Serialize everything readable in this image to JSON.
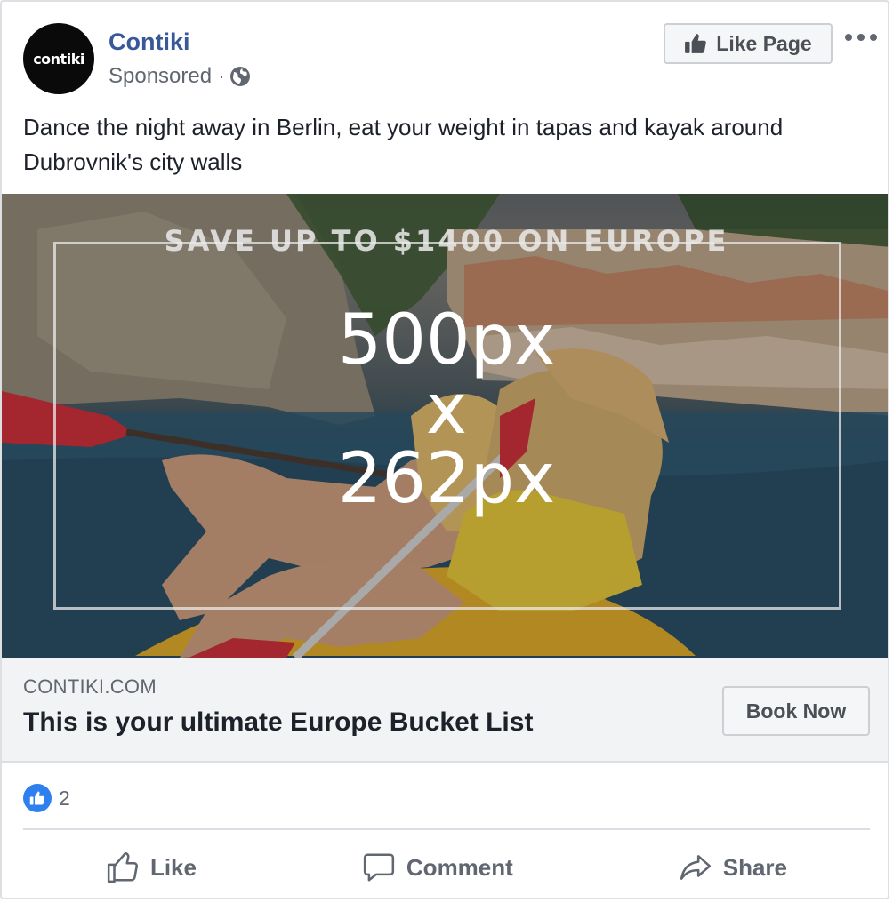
{
  "post": {
    "page_name": "Contiki",
    "avatar_text": "contiki",
    "sponsored_label": "Sponsored",
    "separator": "·",
    "privacy_icon": "globe-icon",
    "like_page_label": "Like Page",
    "more_icon": "ellipsis-icon",
    "body_text": "Dance the night away in Berlin, eat your weight in tapas and kayak around Dubrovnik's city walls"
  },
  "image": {
    "promo_text": "SAVE UP TO $1400 ON EUROPE",
    "dimension_line_1": "500px",
    "dimension_line_2": "x",
    "dimension_line_3": "262px"
  },
  "link": {
    "domain": "CONTIKI.COM",
    "headline": "This is your ultimate Europe Bucket List",
    "cta_label": "Book Now"
  },
  "reactions": {
    "icon": "thumbs-up-icon",
    "count": "2"
  },
  "actions": {
    "like_label": "Like",
    "comment_label": "Comment",
    "share_label": "Share"
  },
  "colors": {
    "page_name": "#385898",
    "reaction_blue": "#2e7ff0",
    "link_bg": "#f2f3f5"
  }
}
